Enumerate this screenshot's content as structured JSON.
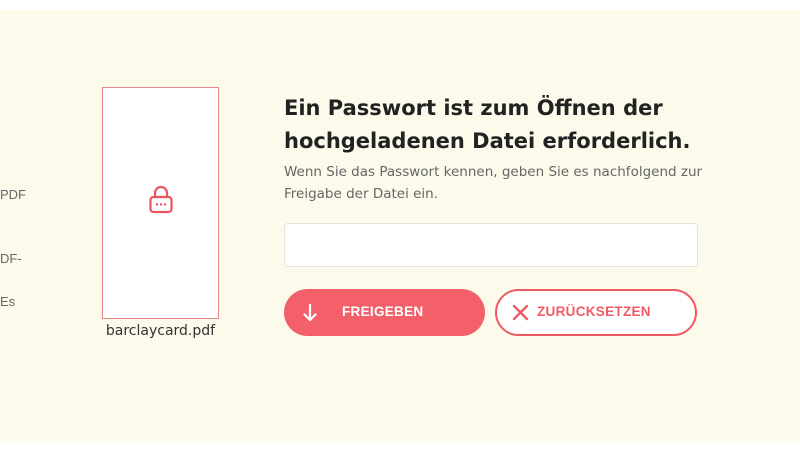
{
  "sidebar": {
    "fragments": [
      "PDF",
      "DF-",
      "Es"
    ]
  },
  "file": {
    "name": "barclaycard.pdf",
    "icon": "lock-icon"
  },
  "dialog": {
    "title": "Ein Passwort ist zum Öffnen der hochgeladenen Datei erforderlich.",
    "subtitle": "Wenn Sie das Passwort kennen, geben Sie es nachfolgend zur Freigabe der Datei ein.",
    "password_value": "",
    "password_placeholder": ""
  },
  "actions": {
    "unlock_label": "FREIGEBEN",
    "reset_label": "ZURÜCKSETZEN"
  },
  "colors": {
    "accent": "#f4606a",
    "background": "#fcfaeb",
    "card_border": "#e8868a"
  }
}
